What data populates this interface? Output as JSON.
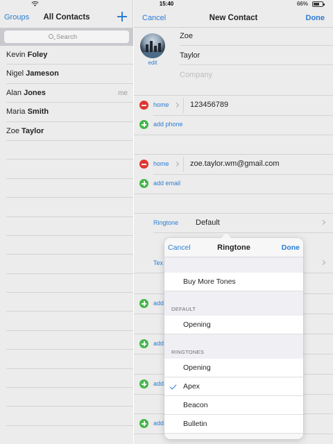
{
  "status_bar": {
    "time": "15:40",
    "battery": "66%",
    "battery_level": 0.66
  },
  "left_panel": {
    "groups_label": "Groups",
    "title": "All Contacts",
    "search_placeholder": "Search",
    "contacts": [
      {
        "first": "Kevin",
        "last": "Foley",
        "tag": ""
      },
      {
        "first": "Nigel",
        "last": "Jameson",
        "tag": ""
      },
      {
        "first": "Alan",
        "last": "Jones",
        "tag": "me"
      },
      {
        "first": "Maria",
        "last": "Smith",
        "tag": ""
      },
      {
        "first": "Zoe",
        "last": "Taylor",
        "tag": ""
      }
    ]
  },
  "new_contact": {
    "cancel_label": "Cancel",
    "title": "New Contact",
    "done_label": "Done",
    "photo_edit_label": "edit",
    "first_name": "Zoe",
    "last_name": "Taylor",
    "company_placeholder": "Company",
    "phone": {
      "label": "home",
      "value": "123456789"
    },
    "add_phone_label": "add phone",
    "email": {
      "label": "home",
      "value": "zoe.taylor.wm@gmail.com"
    },
    "add_email_label": "add email",
    "ringtone_label": "Ringtone",
    "ringtone_value": "Default",
    "text_tone_label_partial": "Tex",
    "add_stub_partial": "add"
  },
  "ringtone_popover": {
    "cancel_label": "Cancel",
    "title": "Ringtone",
    "done_label": "Done",
    "store_item": "Buy More Tones",
    "default_header": "DEFAULT",
    "default_item": "Opening",
    "ringtones_header": "RINGTONES",
    "ringtones": [
      {
        "name": "Opening",
        "selected": false
      },
      {
        "name": "Apex",
        "selected": true
      },
      {
        "name": "Beacon",
        "selected": false
      },
      {
        "name": "Bulletin",
        "selected": false
      }
    ]
  },
  "colors": {
    "accent": "#2b7cd3",
    "delete": "#e0352f",
    "add": "#43b649"
  }
}
